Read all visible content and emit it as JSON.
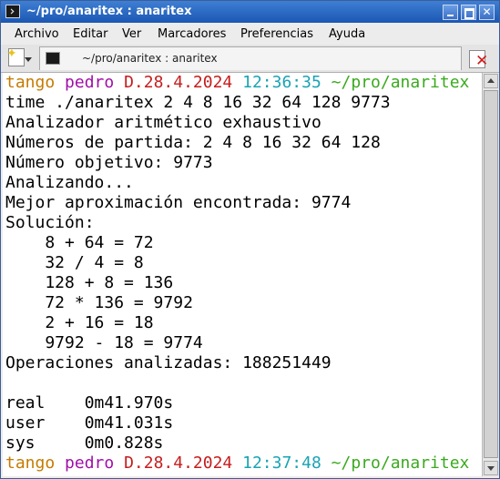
{
  "window": {
    "title": "~/pro/anaritex : anaritex"
  },
  "menu": [
    "Archivo",
    "Editar",
    "Ver",
    "Marcadores",
    "Preferencias",
    "Ayuda"
  ],
  "tab": {
    "label": "~/pro/anaritex : anaritex"
  },
  "prompt1": {
    "user": "tango",
    "host": "pedro",
    "date": "D.28.4.2024",
    "time": "12:36:35",
    "path": "~/pro/anaritex"
  },
  "output": [
    "time ./anaritex 2 4 8 16 32 64 128 9773",
    "Analizador aritmético exhaustivo",
    "Números de partida: 2 4 8 16 32 64 128",
    "Número objetivo: 9773",
    "Analizando...",
    "Mejor aproximación encontrada: 9774",
    "Solución:",
    "    8 + 64 = 72",
    "    32 / 4 = 8",
    "    128 + 8 = 136",
    "    72 * 136 = 9792",
    "    2 + 16 = 18",
    "    9792 - 18 = 9774",
    "Operaciones analizadas: 188251449",
    "",
    "real    0m41.970s",
    "user    0m41.031s",
    "sys     0m0.828s"
  ],
  "prompt2": {
    "user": "tango",
    "host": "pedro",
    "date": "D.28.4.2024",
    "time": "12:37:48",
    "path": "~/pro/anaritex"
  },
  "icons": {
    "minimize": "minimize-icon",
    "maximize": "maximize-icon",
    "close": "close-icon",
    "new_tab": "new-tab-icon",
    "close_tab": "close-tab-icon",
    "terminal": "terminal-icon"
  },
  "colors": {
    "user": "#c47b00",
    "host": "#a00fa8",
    "date": "#c61d1d",
    "time": "#1aa3b3",
    "path": "#3aaa1e"
  }
}
